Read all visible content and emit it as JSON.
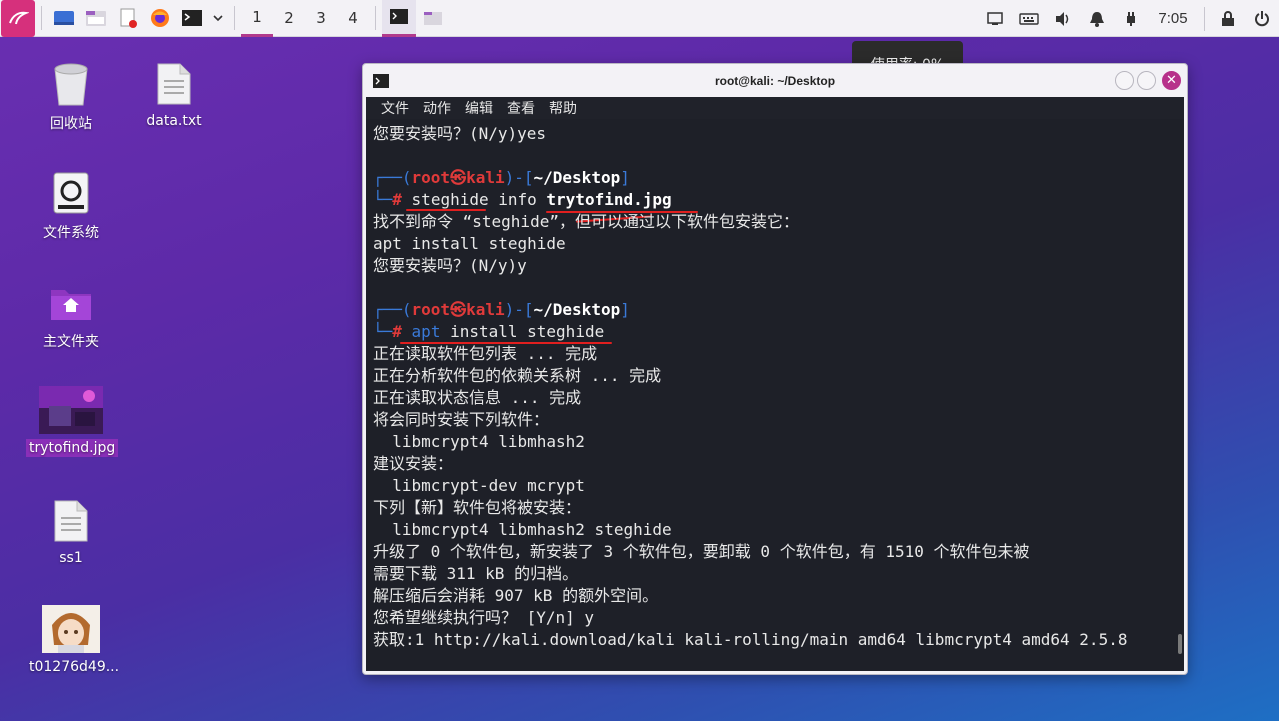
{
  "panel": {
    "workspaces": [
      "1",
      "2",
      "3",
      "4"
    ],
    "active_workspace": "1",
    "clock": "7:05",
    "launchers": [
      "desktop-icon",
      "file-manager-icon",
      "text-editor-icon",
      "firefox-icon",
      "terminal-icon",
      "chevron-down-icon"
    ]
  },
  "tooltip": {
    "text": "使用率: 0%"
  },
  "desktop": {
    "icons": [
      {
        "label": "回收站"
      },
      {
        "label": "data.txt"
      },
      {
        "label": "文件系统"
      },
      {
        "label": "主文件夹"
      },
      {
        "label": "trytofind.jpg"
      },
      {
        "label": "ss1"
      },
      {
        "label": "t01276d49..."
      }
    ]
  },
  "terminal": {
    "title": "root@kali: ~/Desktop",
    "menu": [
      "文件",
      "动作",
      "编辑",
      "查看",
      "帮助"
    ],
    "prompt": {
      "user": "root",
      "host": "kali",
      "dir": "~/Desktop",
      "hash": "#"
    },
    "lines": {
      "l0": "您要安装吗？(N/y)yes",
      "cmd1_a": "steghide",
      "cmd1_b": " info ",
      "cmd1_c": "trytofind.jpg",
      "l3": "找不到命令 “steghide”，但可以通过以下软件包安装它：",
      "l4": "apt install steghide",
      "l5": "您要安装吗？(N/y)y",
      "cmd2_a": "apt",
      "cmd2_b": " install steghide",
      "l8": "正在读取软件包列表 ... 完成",
      "l9": "正在分析软件包的依赖关系树 ... 完成",
      "l10": "正在读取状态信息 ... 完成",
      "l11": "将会同时安装下列软件：",
      "l12": "  libmcrypt4 libmhash2",
      "l13": "建议安装：",
      "l14": "  libmcrypt-dev mcrypt",
      "l15": "下列【新】软件包将被安装：",
      "l16": "  libmcrypt4 libmhash2 steghide",
      "l17": "升级了 0 个软件包，新安装了 3 个软件包，要卸载 0 个软件包，有 1510 个软件包未被",
      "l18": "需要下载 311 kB 的归档。",
      "l19": "解压缩后会消耗 907 kB 的额外空间。",
      "l20": "您希望继续执行吗？ [Y/n] y",
      "l21": "获取:1 http://kali.download/kali kali-rolling/main amd64 libmcrypt4 amd64 2.5.8"
    }
  },
  "colors": {
    "accent": "#b13a8c",
    "prompt_blue": "#3a7ad9",
    "prompt_red": "#e03a3a",
    "terminal_bg": "#1e2028"
  }
}
